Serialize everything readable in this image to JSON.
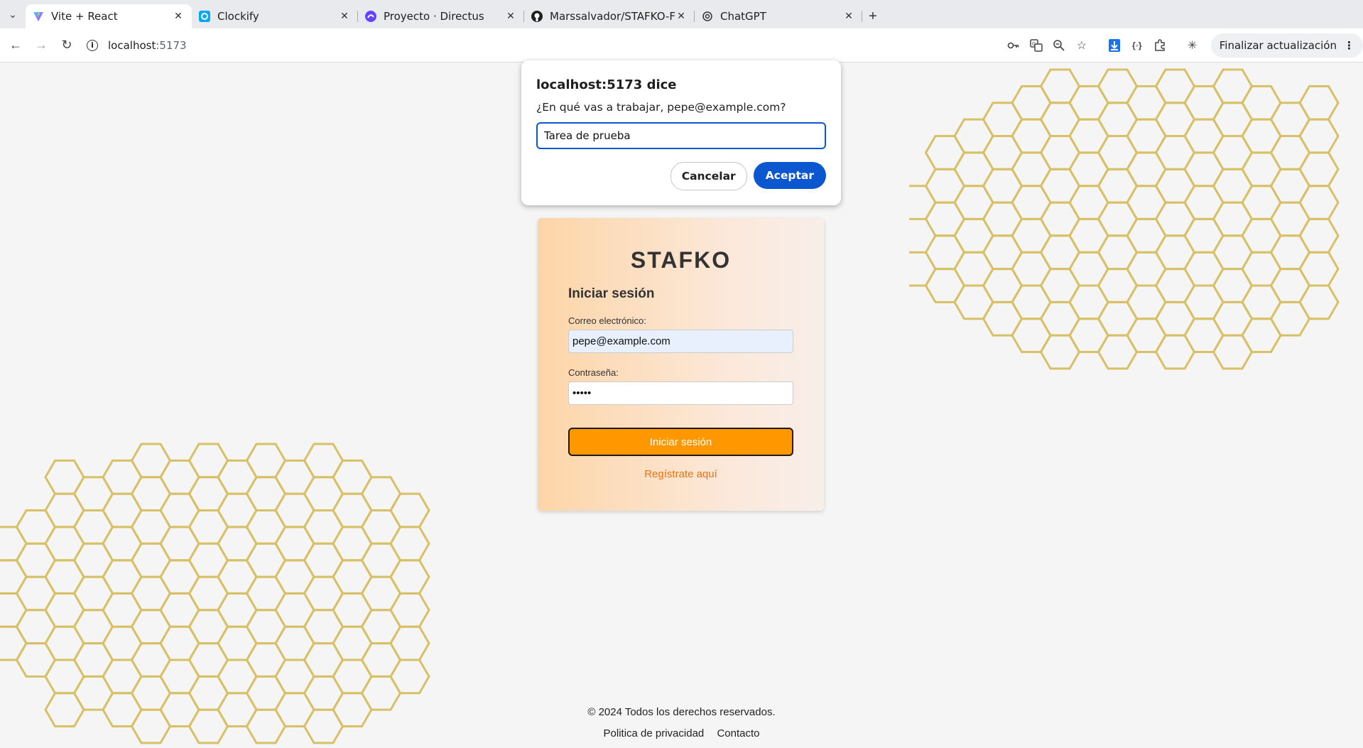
{
  "browser": {
    "tabs": [
      {
        "title": "Vite + React",
        "icon": "vite-icon",
        "active": true
      },
      {
        "title": "Clockify",
        "icon": "clockify-icon",
        "active": false
      },
      {
        "title": "Proyecto · Directus",
        "icon": "directus-icon",
        "active": false
      },
      {
        "title": "Marssalvador/STAFKO-F",
        "icon": "github-icon",
        "active": false
      },
      {
        "title": "ChatGPT",
        "icon": "chatgpt-icon",
        "active": false
      }
    ],
    "address": {
      "host": "localhost",
      "port": ":5173"
    },
    "update_button": "Finalizar actualización"
  },
  "dialog": {
    "title": "localhost:5173 dice",
    "message": "¿En qué vas a trabajar, pepe@example.com?",
    "input_value": "Tarea de prueba",
    "cancel_label": "Cancelar",
    "accept_label": "Aceptar"
  },
  "login": {
    "brand": "STAFKO",
    "heading": "Iniciar sesión",
    "email_label": "Correo electrónico:",
    "email_value": "pepe@example.com",
    "password_label": "Contraseña:",
    "password_value": "•••••",
    "submit_label": "Iniciar sesión",
    "register_link": "Regístrate aquí"
  },
  "footer": {
    "copyright": "© 2024 Todos los derechos reservados.",
    "links": [
      "Politica de privacidad",
      "Contacto"
    ]
  },
  "colors": {
    "accent": "#0b57d0",
    "submit": "#ff9800",
    "link": "#e8730e",
    "honeycomb": "#d8c067"
  }
}
